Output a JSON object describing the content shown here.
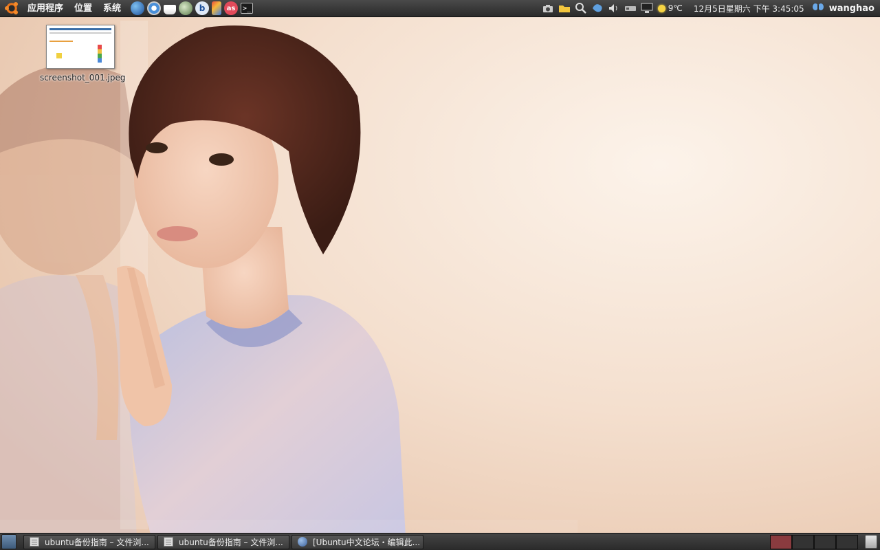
{
  "top_panel": {
    "menus": [
      "应用程序",
      "位置",
      "系统"
    ],
    "launchers": [
      "globe-icon",
      "chromium-icon",
      "coffee-icon",
      "network-icon",
      "bluetooth-icon",
      "audio-icon",
      "lastfm-icon",
      "terminal-icon"
    ],
    "tray": {
      "weather_temp": "9℃",
      "clock": "12月5日星期六 下午 3:45:05",
      "username": "wanghao"
    }
  },
  "desktop": {
    "icons": [
      {
        "label": "screenshot_001.jpeg"
      }
    ]
  },
  "bottom_panel": {
    "tasks": [
      {
        "label": "ubuntu备份指南 – 文件浏...",
        "icon": "document-icon"
      },
      {
        "label": "ubuntu备份指南 – 文件浏...",
        "icon": "document-icon"
      },
      {
        "label": "[Ubuntu中文论坛・编辑此...",
        "icon": "browser-icon"
      }
    ],
    "workspaces": 4,
    "active_workspace": 1
  },
  "colors": {
    "panel": "#2e2e2e",
    "active_workspace": "#8a3b3f",
    "accent_orange": "#e8741c"
  }
}
